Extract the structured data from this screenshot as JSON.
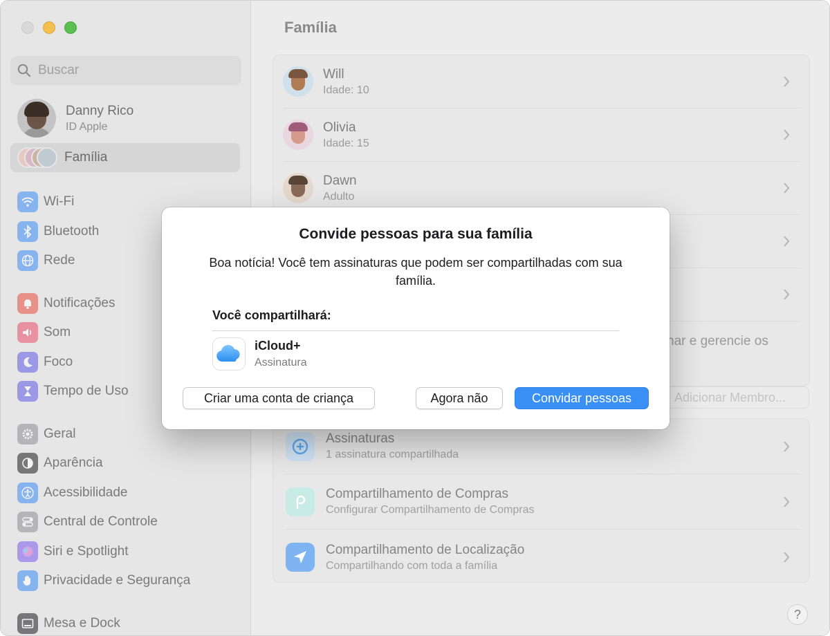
{
  "sidebar": {
    "search": {
      "placeholder": "Buscar"
    },
    "account": {
      "name": "Danny Rico",
      "subtitle": "ID Apple"
    },
    "family": {
      "label": "Família"
    },
    "items": [
      {
        "label": "Wi-Fi",
        "icon": "wifi-icon",
        "color": "#3b8af5"
      },
      {
        "label": "Bluetooth",
        "icon": "bluetooth-icon",
        "color": "#3b8af5"
      },
      {
        "label": "Rede",
        "icon": "globe-icon",
        "color": "#3b8af5"
      },
      {
        "label": "Notificações",
        "icon": "bell-icon",
        "color": "#eb4d3d"
      },
      {
        "label": "Som",
        "icon": "speaker-icon",
        "color": "#eb4d6a"
      },
      {
        "label": "Foco",
        "icon": "moon-icon",
        "color": "#5e5ce6"
      },
      {
        "label": "Tempo de Uso",
        "icon": "hourglass-icon",
        "color": "#5e5ce6"
      },
      {
        "label": "Geral",
        "icon": "gear-icon",
        "color": "#8e8e93"
      },
      {
        "label": "Aparência",
        "icon": "appearance-icon",
        "color": "#1d1d1f"
      },
      {
        "label": "Acessibilidade",
        "icon": "accessibility-icon",
        "color": "#3b8af5"
      },
      {
        "label": "Central de Controle",
        "icon": "control-center-icon",
        "color": "#8e8e93"
      },
      {
        "label": "Siri e Spotlight",
        "icon": "siri-icon",
        "color": "#7a5cf0"
      },
      {
        "label": "Privacidade e Segurança",
        "icon": "hand-icon",
        "color": "#3b8af5"
      },
      {
        "label": "Mesa e Dock",
        "icon": "dock-icon",
        "color": "#1d1d1f"
      }
    ]
  },
  "main": {
    "title": "Família",
    "members": [
      {
        "name": "Will",
        "detail": "Idade: 10"
      },
      {
        "name": "Olivia",
        "detail": "Idade: 15"
      },
      {
        "name": "Dawn",
        "detail": "Adulto"
      }
    ],
    "partial_text": "har e gerencie os",
    "add_member_label": "Adicionar Membro...",
    "features": [
      {
        "title": "Assinaturas",
        "subtitle": "1 assinatura compartilhada",
        "icon": "subscriptions-icon",
        "color": "#5aa9f0"
      },
      {
        "title": "Compartilhamento de Compras",
        "subtitle": "Configurar Compartilhamento de Compras",
        "icon": "purchase-sharing-icon",
        "color": "#4fc3b4"
      },
      {
        "title": "Compartilhamento de Localização",
        "subtitle": "Compartilhando com toda a família",
        "icon": "location-arrow-icon",
        "color": "#3b8af5"
      }
    ],
    "help_label": "?"
  },
  "dialog": {
    "title": "Convide pessoas para sua família",
    "message": "Boa notícia! Você tem assinaturas que podem ser compartilhadas com sua família.",
    "section_label": "Você compartilhará:",
    "item": {
      "name": "iCloud+",
      "subtitle": "Assinatura",
      "icon": "icloud-icon"
    },
    "buttons": {
      "child_account": "Criar uma conta de criança",
      "not_now": "Agora não",
      "invite": "Convidar pessoas"
    },
    "accent": "#3a8ff5"
  }
}
